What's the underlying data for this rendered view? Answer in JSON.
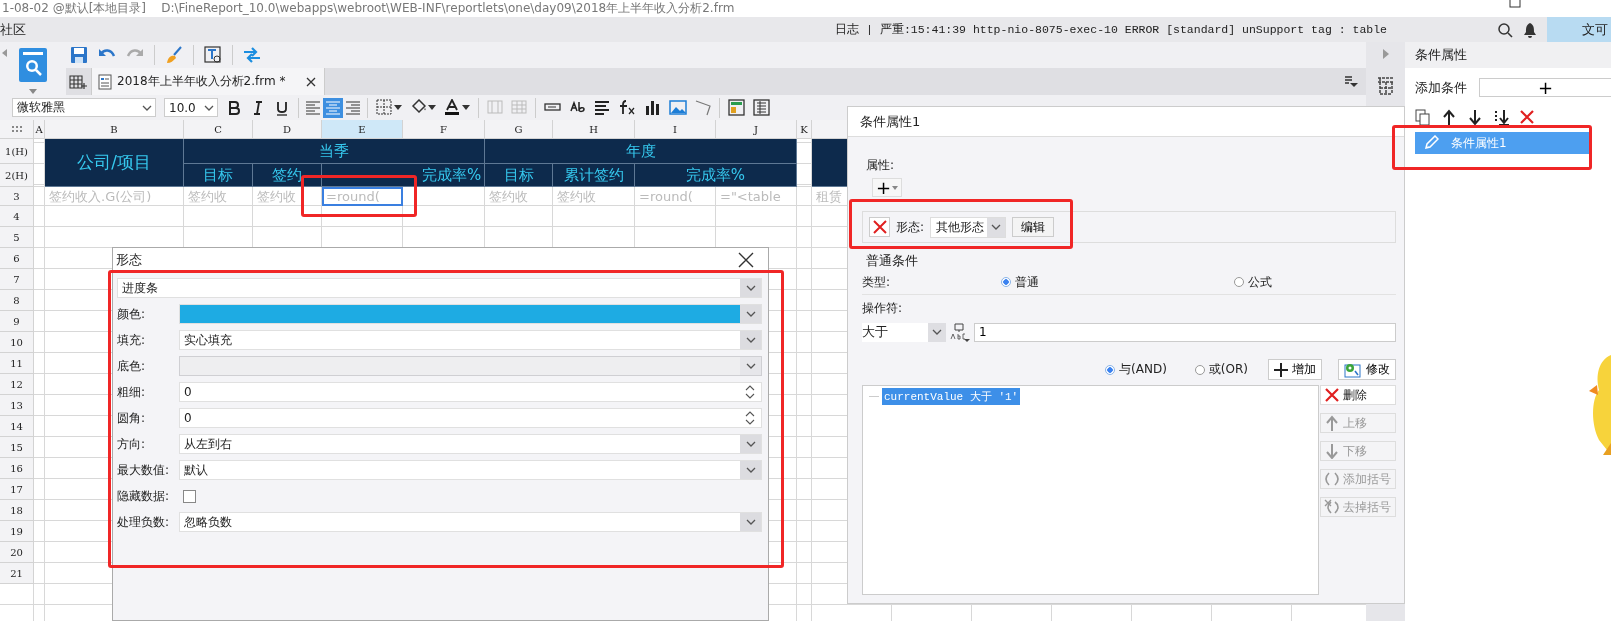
{
  "title_bar": {
    "title": "1-08-02 @默认[本地目录]    D:\\FineReport_10.0\\webapps\\webroot\\WEB-INF\\reportlets\\one\\day09\\2018年上半年收入分析2.frm"
  },
  "menu_bar": {
    "menu": "社区",
    "log": "日志 | 严重:15:41:39 http-nio-8075-exec-10 ERROR [standard] unSupport tag : table",
    "user": "文可"
  },
  "document_tab": {
    "label": "2018年上半年收入分析2.frm *"
  },
  "format_toolbar": {
    "font": "微软雅黑",
    "size": "10.0",
    "align": [
      {
        "selected": false
      },
      {
        "selected": true
      },
      {
        "selected": false
      }
    ]
  },
  "sheet": {
    "columns": [
      "A",
      "B",
      "C",
      "D",
      "E",
      "F",
      "G",
      "H",
      "I",
      "J",
      "K"
    ],
    "rows": [
      "1(H)",
      "2(H)",
      "3",
      "4",
      "5",
      "6",
      "7",
      "8",
      "9",
      "10",
      "11",
      "12",
      "13",
      "14",
      "15",
      "16",
      "17",
      "18",
      "19",
      "20",
      "21"
    ],
    "header_cells": [
      "公司/项目",
      "当季",
      "年度",
      "目标",
      "签约",
      "完成率%",
      "目标",
      "累计签约",
      "完成率%"
    ],
    "row_3": [
      {
        "text": "签约收入.G(公司)",
        "selected": false
      },
      {
        "text": "签约收",
        "selected": false
      },
      {
        "text": "签约收",
        "selected": false
      },
      {
        "text": "=round(",
        "selected": true
      },
      {
        "text": "签约收",
        "selected": false
      },
      {
        "text": "签约收",
        "selected": false
      },
      {
        "text": "=round(",
        "selected": false
      },
      {
        "text": "=\"<table",
        "selected": false
      },
      {
        "text": "租赁",
        "selected": false
      }
    ]
  },
  "form_dialog": {
    "title": "形态",
    "style": "进度条",
    "fields": [
      {
        "kind": "color",
        "label": "颜色:",
        "color": "#1eabe3",
        "disabled": false
      },
      {
        "kind": "select",
        "label": "填充:",
        "value": "实心填充",
        "disabled": false
      },
      {
        "kind": "select",
        "label": "底色:",
        "disabled": true
      },
      {
        "kind": "spinner",
        "label": "粗细:",
        "value": "0",
        "disabled": false
      },
      {
        "kind": "spinner",
        "label": "圆角:",
        "value": "0",
        "disabled": false
      },
      {
        "kind": "select",
        "label": "方向:",
        "value": "从左到右",
        "disabled": false
      },
      {
        "kind": "select",
        "label": "最大数值:",
        "value": "默认",
        "disabled": false
      },
      {
        "kind": "checkbox",
        "label": "隐藏数据:",
        "checked": false,
        "disabled": false
      },
      {
        "kind": "select",
        "label": "处理负数:",
        "value": "忽略负数",
        "disabled": false
      }
    ]
  },
  "condition_dialog": {
    "title": "条件属性1",
    "properties_label": "属性:",
    "add_button": "+",
    "style_row": {
      "label": "形态:",
      "value": "其他形态",
      "edit_button": "编辑"
    },
    "group_label": "普通条件",
    "type_label": "类型:",
    "type_options": [
      {
        "label": "普通",
        "selected": true
      },
      {
        "label": "公式",
        "selected": false
      }
    ],
    "operator_label": "操作符:",
    "operator": "大于",
    "operand": "1",
    "logic_options": [
      {
        "label": "与(AND)",
        "selected": true
      },
      {
        "label": "或(OR)",
        "selected": false
      }
    ],
    "add_label": "增加",
    "modify_label": "修改",
    "conditions": [
      {
        "text": "currentValue 大于 '1'",
        "selected": true
      }
    ],
    "actions": [
      {
        "kind": "delete",
        "label": "删除",
        "disabled": false
      },
      {
        "kind": "up",
        "label": "上移",
        "disabled": true
      },
      {
        "kind": "down",
        "label": "下移",
        "disabled": true
      },
      {
        "kind": "add-paren",
        "label": "添加括号",
        "disabled": true
      },
      {
        "kind": "remove-paren",
        "label": "去掉括号",
        "disabled": true
      }
    ]
  },
  "right_panel": {
    "title": "条件属性",
    "add_label": "添加条件",
    "add_button": "+",
    "conditions": [
      {
        "label": "条件属性1",
        "selected": true
      }
    ]
  }
}
